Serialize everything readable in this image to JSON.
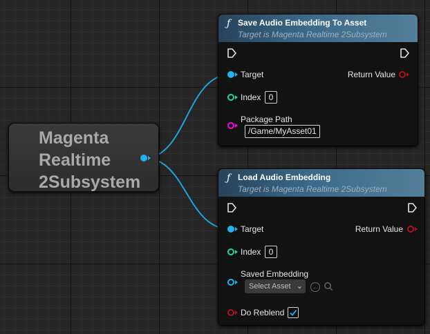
{
  "subsystem_node": {
    "label": "Magenta\nRealtime\n2Subsystem"
  },
  "nodes": [
    {
      "title": "Save Audio Embedding To Asset",
      "subtitle": "Target is Magenta Realtime 2Subsystem",
      "target_label": "Target",
      "return_label": "Return Value",
      "index_label": "Index",
      "index_value": "0",
      "package_path_label": "Package Path",
      "package_path_value": "/Game/MyAsset01"
    },
    {
      "title": "Load Audio Embedding",
      "subtitle": "Target is Magenta Realtime 2Subsystem",
      "target_label": "Target",
      "return_label": "Return Value",
      "index_label": "Index",
      "index_value": "0",
      "saved_embedding_label": "Saved Embedding",
      "select_asset_label": "Select Asset",
      "do_reblend_label": "Do Reblend",
      "do_reblend_checked": true
    }
  ],
  "colors": {
    "object_pin": "#1fb2ee",
    "int_pin": "#20d8a8",
    "string_pin": "#f20ae0",
    "bool_pin": "#b0121a",
    "header_start": "#27435a",
    "header_end": "#557f99"
  },
  "icons": {
    "function": "function-icon",
    "exec": "exec-pin-icon",
    "browse": "browse-asset-icon",
    "search": "search-icon",
    "dropdown": "chevron-down-icon",
    "check": "check-icon"
  }
}
